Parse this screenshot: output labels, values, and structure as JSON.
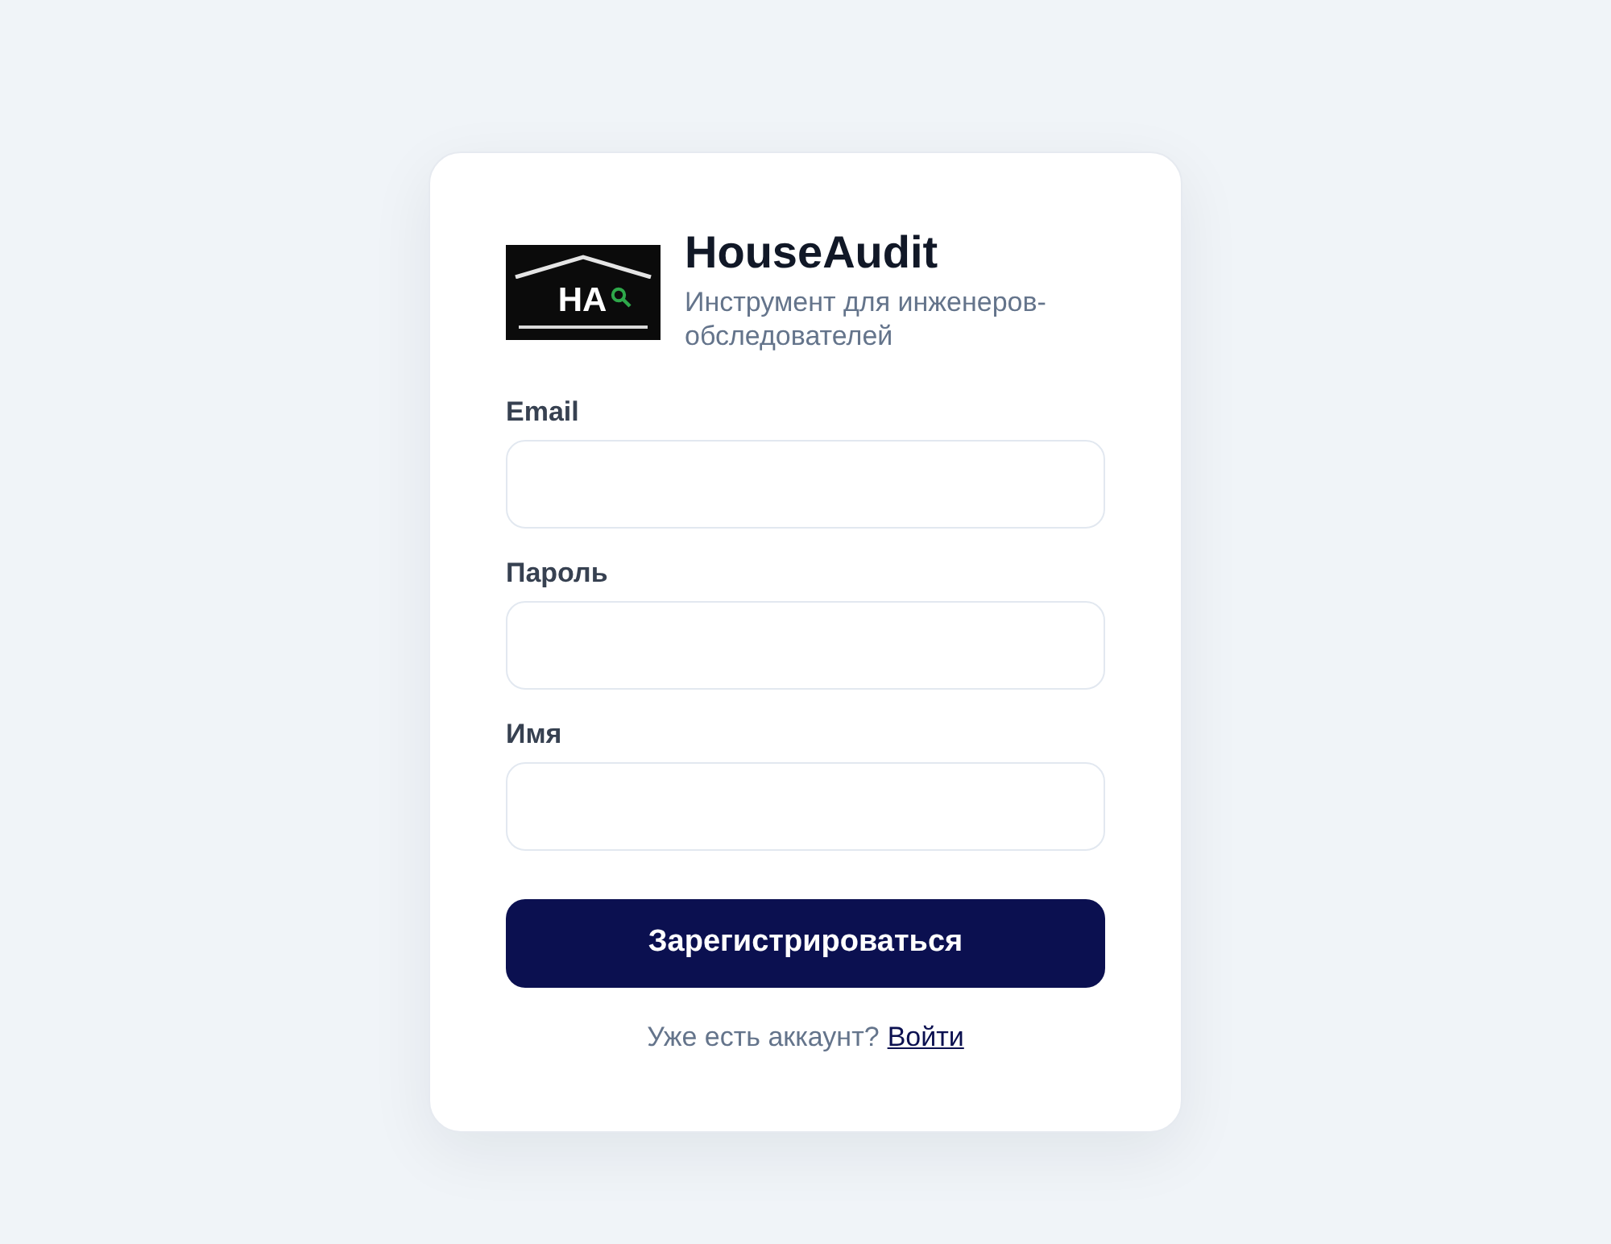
{
  "brand": {
    "logo_text": "HA",
    "name": "HouseAudit",
    "tagline": "Инструмент для инженеров-обследователей"
  },
  "fields": [
    {
      "label": "Email"
    },
    {
      "label": "Пароль"
    },
    {
      "label": "Имя"
    }
  ],
  "submit_button": "Зарегистрироваться",
  "footer": {
    "text": "Уже есть аккаунт?",
    "link": "Войти"
  }
}
